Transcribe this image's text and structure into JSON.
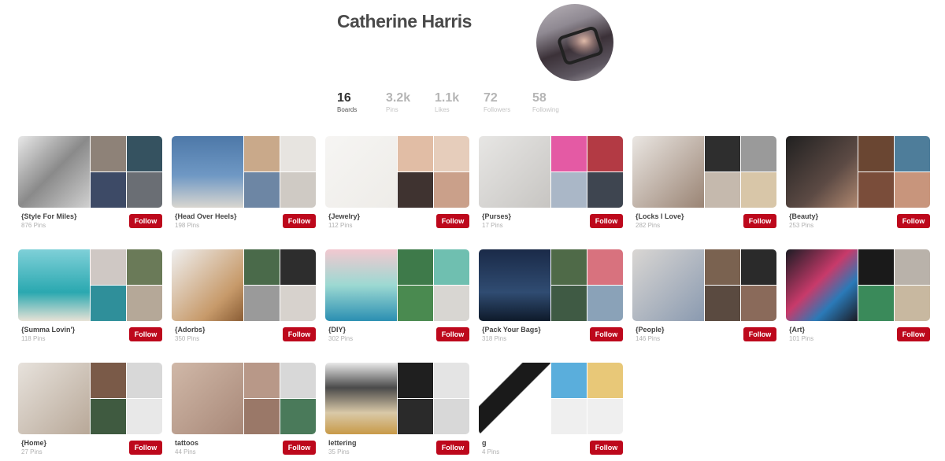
{
  "profile": {
    "name": "Catherine Harris",
    "stats": [
      {
        "value": "16",
        "label": "Boards",
        "active": true
      },
      {
        "value": "3.2k",
        "label": "Pins",
        "active": false
      },
      {
        "value": "1.1k",
        "label": "Likes",
        "active": false
      },
      {
        "value": "72",
        "label": "Followers",
        "active": false
      },
      {
        "value": "58",
        "label": "Following",
        "active": false
      }
    ]
  },
  "follow_label": "Follow",
  "boards": [
    {
      "name": "{Style For Miles}",
      "pins": "876 Pins",
      "colors": [
        "linear-gradient(135deg,#e8e8e8,#8a8a8a 50%,#d0d0d0)",
        "#8e8278",
        "#355260",
        "#3d4a66",
        "#6a6e74"
      ]
    },
    {
      "name": "{Head Over Heels}",
      "pins": "198 Pins",
      "colors": [
        "linear-gradient(180deg,#4d78a8 0%,#6f98c4 55%,#d9d6d0 100%)",
        "#c9a98a",
        "#e7e4e0",
        "#6d86a4",
        "#cfcac4"
      ]
    },
    {
      "name": "{Jewelry}",
      "pins": "112 Pins",
      "colors": [
        "linear-gradient(135deg,#f6f5f3,#eeece8)",
        "#e1bda5",
        "#e6cdbb",
        "#3f3330",
        "#caa08a"
      ]
    },
    {
      "name": "{Purses}",
      "pins": "17 Pins",
      "colors": [
        "linear-gradient(135deg,#e7e6e4,#c7c5c2)",
        "#e45aa4",
        "#b33a44",
        "#aab7c7",
        "#3e4550"
      ]
    },
    {
      "name": "{Locks I Love}",
      "pins": "282 Pins",
      "colors": [
        "linear-gradient(135deg,#eae6e2,#9a8474)",
        "#2e2e2e",
        "#9a9a9a",
        "#c5b9ad",
        "#d8c6a8"
      ]
    },
    {
      "name": "{Beauty}",
      "pins": "253 Pins",
      "colors": [
        "linear-gradient(135deg,#202020,#5c4a44 60%,#b08870)",
        "#6a4632",
        "#4e7d9a",
        "#7a4d3a",
        "#c8957c"
      ]
    },
    {
      "name": "{Summa Lovin'}",
      "pins": "118 Pins",
      "colors": [
        "linear-gradient(180deg,#7fd0d8 0%,#2aa8b0 60%,#e7e2d6 100%)",
        "#cfc8c4",
        "#6a7a58",
        "#2f8f9a",
        "#b5a898"
      ]
    },
    {
      "name": "{Adorbs}",
      "pins": "350 Pins",
      "colors": [
        "linear-gradient(135deg,#efefef,#c79a6a 70%,#8a5d35)",
        "#4a6a4a",
        "#2d2d2d",
        "#9a9a9a",
        "#d7d2cd"
      ]
    },
    {
      "name": "{DIY}",
      "pins": "302 Pins",
      "colors": [
        "linear-gradient(180deg,#f2c8d0 0%,#9cd9d2 50%,#2b8fb2 100%)",
        "#3e7a4a",
        "#6fbfb0",
        "#4a8a50",
        "#d8d6d2"
      ]
    },
    {
      "name": "{Pack Your Bags}",
      "pins": "318 Pins",
      "colors": [
        "linear-gradient(180deg,#1a2a48 0%,#304c72 60%,#0e1a2a 100%)",
        "#4f6a48",
        "#d8727e",
        "#3f5a44",
        "#8aa2b8"
      ]
    },
    {
      "name": "{People}",
      "pins": "146 Pins",
      "colors": [
        "linear-gradient(135deg,#d9d6d3,#8a9ab0)",
        "#7a6250",
        "#2a2a2a",
        "#5a4a40",
        "#8a6a5a"
      ]
    },
    {
      "name": "{Art}",
      "pins": "101 Pins",
      "colors": [
        "linear-gradient(135deg,#1c1c24,#c83a6a 45%,#2a7ab8 70%,#1c1c24)",
        "#1a1a1a",
        "#b9b2aa",
        "#3a8a5a",
        "#c8b8a0"
      ]
    },
    {
      "name": "{Home}",
      "pins": "27 Pins",
      "colors": [
        "linear-gradient(135deg,#e7e2dc,#b8a898)",
        "#7a5a48",
        "#d8d8d8",
        "#3f5a40",
        "#e8e8e8"
      ]
    },
    {
      "name": "tattoos",
      "pins": "44 Pins",
      "colors": [
        "linear-gradient(135deg,#d0b8a8,#a88878)",
        "#b89888",
        "#d8d8d8",
        "#9a7868",
        "#4a7a5a"
      ]
    },
    {
      "name": "lettering",
      "pins": "35 Pins",
      "colors": [
        "linear-gradient(180deg,#eaeaea 0%,#4a4a4a 35%,#d9c9a8 70%,#c89a48 100%)",
        "#1f1f1f",
        "#e4e4e4",
        "#2a2a2a",
        "#d8d8d8"
      ]
    },
    {
      "name": "g",
      "pins": "4 Pins",
      "colors": [
        "linear-gradient(135deg,#ffffff 30%,#1a1a1a 31%,#1a1a1a 50%,#ffffff 51%)",
        "#5aaedc",
        "#e8c878",
        "#efefef",
        "#efefef"
      ]
    }
  ]
}
